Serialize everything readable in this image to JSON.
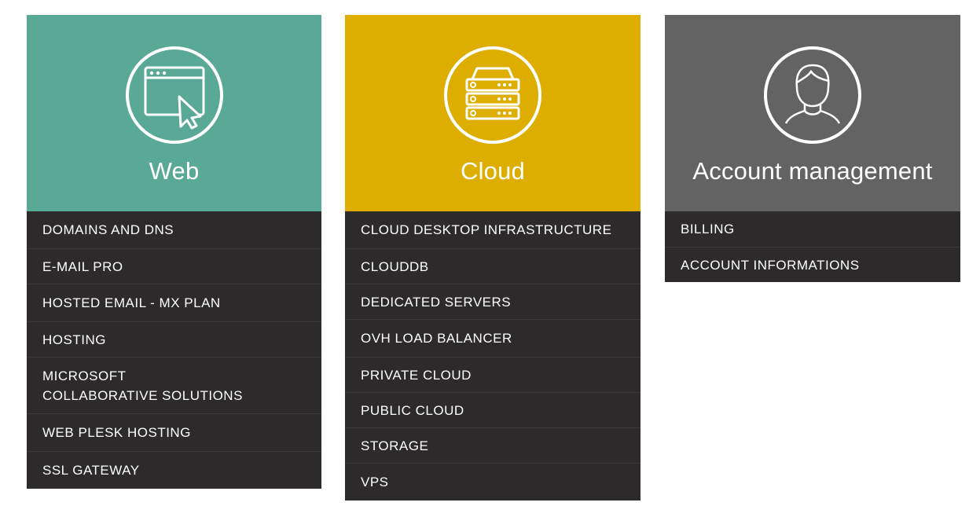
{
  "cards": [
    {
      "title": "Web",
      "icon": "browser-cursor-icon",
      "color": "#5aa997",
      "items": [
        {
          "label": "DOMAINS AND DNS"
        },
        {
          "label": "E-MAIL PRO"
        },
        {
          "label": "HOSTED EMAIL - MX PLAN"
        },
        {
          "label": "HOSTING"
        },
        {
          "label_line1": "MICROSOFT",
          "label_line2": "COLLABORATIVE SOLUTIONS"
        },
        {
          "label": "WEB PLESK HOSTING"
        },
        {
          "label": "SSL GATEWAY"
        }
      ]
    },
    {
      "title": "Cloud",
      "icon": "server-icon",
      "color": "#ddae00",
      "items": [
        {
          "label": "CLOUD DESKTOP INFRASTRUCTURE"
        },
        {
          "label": "CLOUDDB"
        },
        {
          "label": "DEDICATED SERVERS"
        },
        {
          "label": "OVH LOAD BALANCER"
        },
        {
          "label": "PRIVATE CLOUD"
        },
        {
          "label": "PUBLIC CLOUD"
        },
        {
          "label": "STORAGE"
        },
        {
          "label": "VPS"
        }
      ]
    },
    {
      "title": "Account management",
      "icon": "user-icon",
      "color": "#636363",
      "items": [
        {
          "label": "BILLING"
        },
        {
          "label": "ACCOUNT INFORMATIONS"
        }
      ]
    }
  ]
}
